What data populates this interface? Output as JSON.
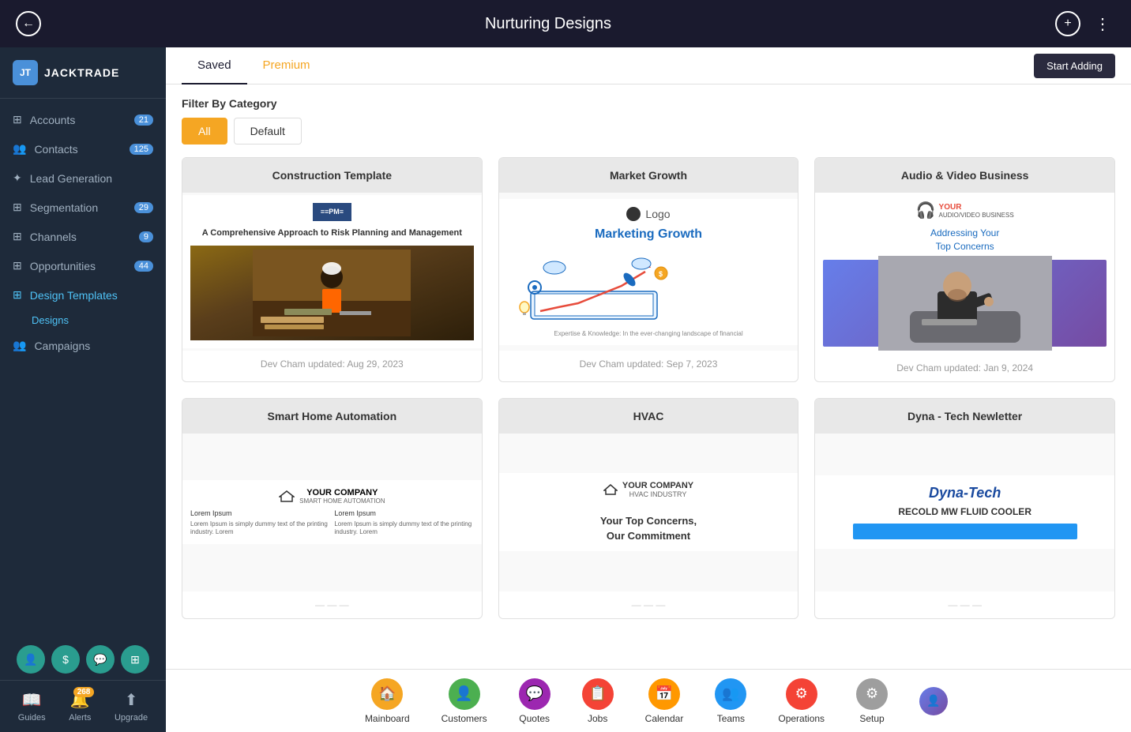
{
  "app": {
    "title": "Nurturing Designs"
  },
  "topbar": {
    "back_icon": "←",
    "add_icon": "+",
    "more_icon": "⋮",
    "start_adding_label": "Start Adding"
  },
  "sidebar": {
    "logo_text": "JACKTRADE",
    "nav_items": [
      {
        "id": "accounts",
        "label": "Accounts",
        "badge": "21",
        "icon": "⊞"
      },
      {
        "id": "contacts",
        "label": "Contacts",
        "badge": "125",
        "icon": "👥"
      },
      {
        "id": "lead-generation",
        "label": "Lead Generation",
        "badge": "",
        "icon": "✦"
      },
      {
        "id": "segmentation",
        "label": "Segmentation",
        "badge": "29",
        "icon": "⊞"
      },
      {
        "id": "channels",
        "label": "Channels",
        "badge": "9",
        "icon": "⊞"
      },
      {
        "id": "opportunities",
        "label": "Opportunities",
        "badge": "44",
        "icon": "⊞"
      },
      {
        "id": "design-templates",
        "label": "Design Templates",
        "badge": "",
        "icon": "⊞",
        "active": true
      },
      {
        "id": "campaigns",
        "label": "Campaigns",
        "badge": "",
        "icon": "👥"
      }
    ],
    "sub_items": [
      {
        "id": "designs",
        "label": "Designs"
      }
    ],
    "bottom_items": [
      {
        "id": "guides",
        "label": "Guides",
        "icon": "📖"
      },
      {
        "id": "alerts",
        "label": "Alerts",
        "icon": "🔔",
        "badge": "268"
      },
      {
        "id": "upgrade",
        "label": "Upgrade",
        "icon": "⬆"
      }
    ]
  },
  "content": {
    "tabs": [
      {
        "id": "saved",
        "label": "Saved",
        "active": true
      },
      {
        "id": "premium",
        "label": "Premium",
        "active": false
      }
    ],
    "filter": {
      "title": "Filter By Category",
      "buttons": [
        {
          "id": "all",
          "label": "All",
          "active": true
        },
        {
          "id": "default",
          "label": "Default",
          "active": false
        }
      ]
    },
    "templates": [
      {
        "id": "construction",
        "title": "Construction Template",
        "subtitle": "A Comprehensive Approach to Risk Planning and Management",
        "updated": "Dev Cham updated: Aug 29, 2023",
        "type": "construction"
      },
      {
        "id": "market-growth",
        "title": "Market Growth",
        "subtitle": "Marketing Growth",
        "tagline": "Expertise & Knowledge: In the ever-changing landscape of financial",
        "updated": "Dev Cham updated: Sep 7, 2023",
        "type": "market"
      },
      {
        "id": "audio-video",
        "title": "Audio & Video Business",
        "concern_text": "Addressing Your\nTop Concerns",
        "updated": "Dev Cham updated: Jan 9, 2024",
        "type": "audio"
      },
      {
        "id": "smart-home",
        "title": "Smart Home Automation",
        "col1_title": "Lorem Ipsum",
        "col2_title": "Lorem Ipsum",
        "col_body": "Lorem Ipsum is simply dummy text of the printing industry. Lorem",
        "type": "smart"
      },
      {
        "id": "hvac",
        "title": "HVAC",
        "content1": "Your Top Concerns,",
        "content2": "Our Commitment",
        "type": "hvac"
      },
      {
        "id": "dyna-tech",
        "title": "Dyna - Tech Newletter",
        "brand": "Dyna-Tech",
        "product": "RECOLD MW FLUID COOLER",
        "type": "dyna"
      }
    ]
  },
  "bottom_nav": {
    "items": [
      {
        "id": "mainboard",
        "label": "Mainboard",
        "icon": "🏠",
        "color": "nav-icon-mainboard"
      },
      {
        "id": "customers",
        "label": "Customers",
        "icon": "👤",
        "color": "nav-icon-customers"
      },
      {
        "id": "quotes",
        "label": "Quotes",
        "icon": "💬",
        "color": "nav-icon-quotes"
      },
      {
        "id": "jobs",
        "label": "Jobs",
        "icon": "📋",
        "color": "nav-icon-jobs"
      },
      {
        "id": "calendar",
        "label": "Calendar",
        "icon": "📅",
        "color": "nav-icon-calendar"
      },
      {
        "id": "teams",
        "label": "Teams",
        "icon": "👥",
        "color": "nav-icon-teams"
      },
      {
        "id": "operations",
        "label": "Operations",
        "icon": "⚙",
        "color": "nav-icon-operations"
      },
      {
        "id": "setup",
        "label": "Setup",
        "icon": "⚙",
        "color": "nav-icon-setup"
      }
    ]
  }
}
